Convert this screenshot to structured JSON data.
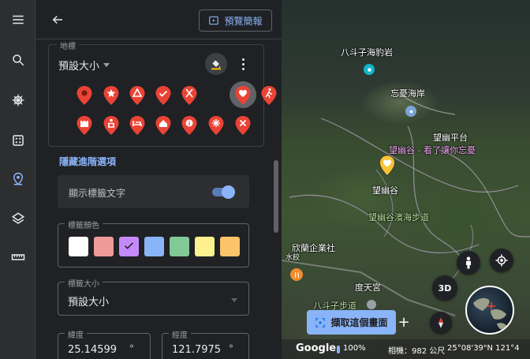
{
  "panel": {
    "preview_label": "預覽簡報",
    "icon_section_legend": "地標",
    "icon_size_value": "預設大小",
    "advanced_link": "隱藏進階選項",
    "show_label_text": "顯示標籤文字",
    "show_label_enabled": true,
    "label_color_legend": "標籤顏色",
    "label_colors": [
      "#ffffff",
      "#ee9a9a",
      "#c58af9",
      "#8ab4f8",
      "#81c995",
      "#fdf08e",
      "#fcc46a"
    ],
    "selected_color_index": 2,
    "label_size_legend": "標籤大小",
    "label_size_value": "預設大小",
    "lat_legend": "緯度",
    "lat_value": "25.14599",
    "lng_legend": "經度",
    "lng_value": "121.7975",
    "degree_unit": "°",
    "accent_color": "#8ab4f8",
    "pin_color": "#ea4335",
    "icons": [
      "circle",
      "star",
      "triangle-alert",
      "check",
      "fork-knife",
      "heart",
      "hiker",
      "castle",
      "person-pin",
      "bed",
      "home",
      "info",
      "sparkle",
      "close"
    ],
    "selected_icon_index": 5
  },
  "map": {
    "labels": {
      "badouzi_harbor": "八斗子海豹岩",
      "wangyou_coast": "忘憂海岸",
      "wangyou_platform": "望幽平台",
      "wangyou_pin_label": "望幽谷 - 看了讓你忘憂",
      "wangyou_valley": "望幽谷",
      "wangyou_trail": "望幽谷濱海步道",
      "company": "欣蘭企業社",
      "company_sub": "水餃",
      "dutian_temple": "度天宮",
      "badouzi_trail": "八斗子步道"
    },
    "btn_3d": "3D",
    "capture_label": "擷取這個畫面",
    "plus_label": "+",
    "footer": {
      "brand": "Google",
      "zoom": "100%",
      "scale": "相機：982 公尺",
      "coords": "25°08'39\"N 121°4"
    }
  }
}
